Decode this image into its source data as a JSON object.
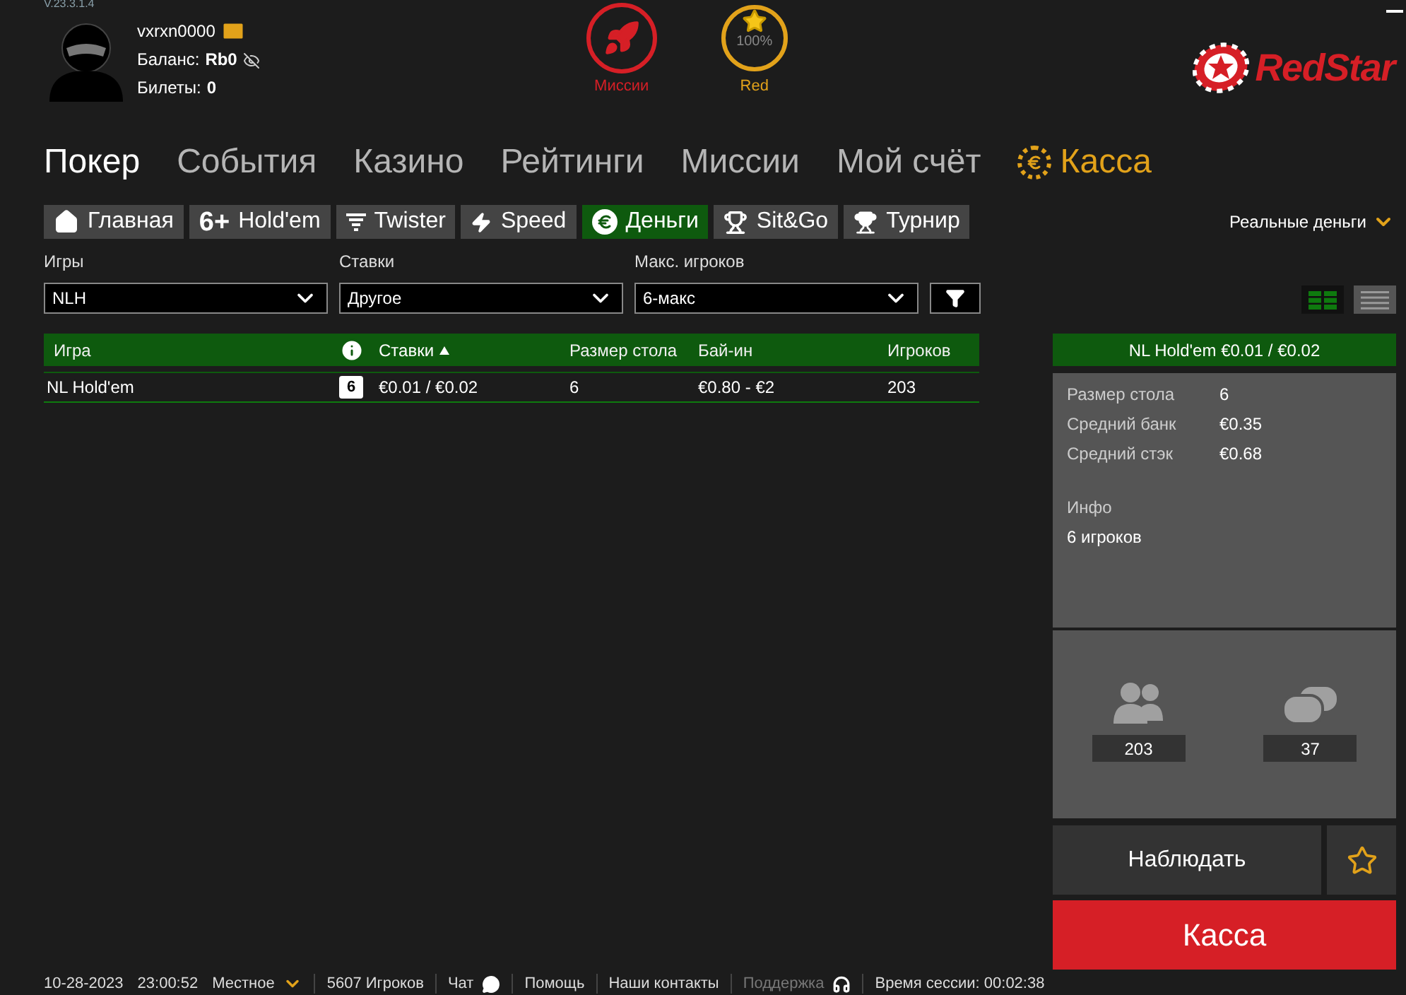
{
  "version": "V.23.3.1.4",
  "user": {
    "name": "vxrxn0000",
    "balance_label": "Баланс:",
    "balance_value": "Rb0",
    "tickets_label": "Билеты:",
    "tickets_value": "0"
  },
  "missions": {
    "label": "Миссии"
  },
  "status_level": {
    "label": "Red",
    "progress": "100%",
    "level": 1
  },
  "logo": {
    "text": "RedStar"
  },
  "nav": [
    {
      "label": "Покер",
      "selected": true,
      "kind": "page"
    },
    {
      "label": "События",
      "selected": false,
      "kind": "page"
    },
    {
      "label": "Казино",
      "selected": false,
      "kind": "page"
    },
    {
      "label": "Рейтинги",
      "selected": false,
      "kind": "page"
    },
    {
      "label": "Миссии",
      "selected": false,
      "kind": "page"
    },
    {
      "label": "Мой счёт",
      "selected": false,
      "kind": "page"
    },
    {
      "label": "Касса",
      "selected": false,
      "kind": "cashier"
    }
  ],
  "tabs": [
    {
      "label": "Главная",
      "selected": false,
      "kind": "home"
    },
    {
      "label": "Hold'em",
      "selected": false,
      "kind": "short",
      "badge": "6+"
    },
    {
      "label": "Twister",
      "selected": false,
      "kind": "twister"
    },
    {
      "label": "Speed",
      "selected": false,
      "kind": "speed"
    },
    {
      "label": "Деньги",
      "selected": true,
      "kind": "cash"
    },
    {
      "label": "Sit&Go",
      "selected": false,
      "kind": "sitgo"
    },
    {
      "label": "Турнир",
      "selected": false,
      "kind": "tournament"
    }
  ],
  "currency_menu": "Реальные деньги",
  "filters": [
    {
      "label": "Игры",
      "value": "NLH"
    },
    {
      "label": "Ставки",
      "value": "Другое"
    },
    {
      "label": "Макс. игроков",
      "value": "6-макс"
    }
  ],
  "view_modes": [
    {
      "kind": "grid",
      "selected": true
    },
    {
      "kind": "list",
      "selected": false
    }
  ],
  "table": {
    "columns": [
      {
        "label": "Игра",
        "kind": "text",
        "sorted": false
      },
      {
        "kind": "info"
      },
      {
        "label": "Ставки",
        "kind": "text",
        "sorted": true
      },
      {
        "label": "Размер стола",
        "kind": "text",
        "sorted": false
      },
      {
        "label": "Бай-ин",
        "kind": "text",
        "sorted": false
      },
      {
        "label": "Игроков",
        "kind": "text",
        "sorted": false
      }
    ],
    "rows": [
      {
        "game": "NL Hold'em",
        "seats_badge": "6",
        "stakes": "€0.01 / €0.02",
        "table_size": "6",
        "buy_in": "€0.80 - €2",
        "players": "203"
      }
    ]
  },
  "details": {
    "title": "NL Hold'em €0.01 / €0.02",
    "fields": [
      {
        "label": "Размер стола",
        "value": "6"
      },
      {
        "label": "Средний банк",
        "value": "€0.35"
      },
      {
        "label": "Средний стэк",
        "value": "€0.68"
      }
    ],
    "info_label": "Инфо",
    "info_value": "6 игроков",
    "stats": [
      {
        "kind": "players",
        "value": "203"
      },
      {
        "kind": "tables",
        "value": "37"
      }
    ]
  },
  "watch_button": "Наблюдать",
  "favorite": {
    "on": false
  },
  "cashier_button": "Касса",
  "status_bar": [
    {
      "kind": "date",
      "text": "10-28-2023"
    },
    {
      "kind": "time",
      "text": "23:00:52"
    },
    {
      "kind": "timezone",
      "text": "Местное"
    },
    {
      "kind": "plain",
      "text": "5607 Игроков"
    },
    {
      "kind": "chat",
      "text": "Чат"
    },
    {
      "kind": "link",
      "text": "Помощь"
    },
    {
      "kind": "link",
      "text": "Наши контакты"
    },
    {
      "kind": "support",
      "text": "Поддержка",
      "disabled": true
    },
    {
      "kind": "plain",
      "text": "Время сессии: 00:02:38"
    }
  ]
}
